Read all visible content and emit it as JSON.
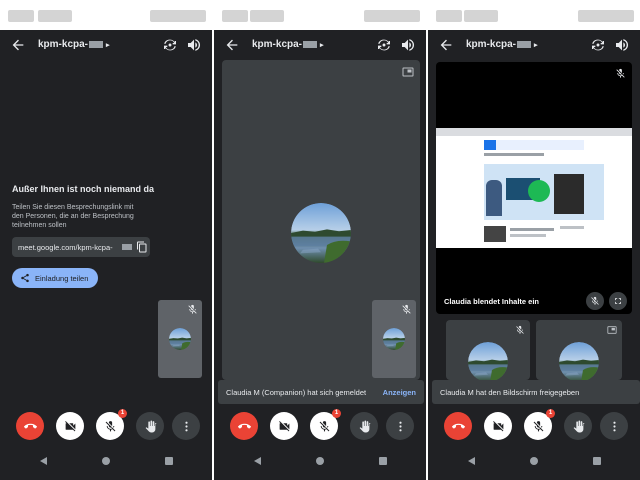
{
  "panels": [
    {
      "title": "kpm-kcpa-",
      "heading": "Außer Ihnen ist noch niemand da",
      "description": "Teilen Sie diesen Besprechungslink mit den Personen, die an der Besprechung teilnehmen sollen",
      "link": "meet.google.com/kpm-kcpa-",
      "share_label": "Einladung teilen"
    },
    {
      "title": "kpm-kcpa-",
      "toast_text": "Claudia M (Companion) hat sich gemeldet",
      "toast_action": "Anzeigen"
    },
    {
      "title": "kpm-kcpa-",
      "presenting_label": "Claudia blendet Inhalte ein",
      "toast_text": "Claudia M hat den Bildschirm freigegeben"
    }
  ],
  "badge_count": "1",
  "icons": {
    "back": "arrow-left-icon",
    "camera_switch": "camera-switch-icon",
    "speaker": "speaker-icon",
    "copy": "copy-icon",
    "share": "share-icon",
    "end_call": "end-call-icon",
    "camera_off": "camera-off-icon",
    "mic_off": "mic-off-icon",
    "raise_hand": "hand-icon",
    "more": "more-vert-icon",
    "pip": "picture-in-picture-icon",
    "fullscreen": "fullscreen-icon"
  },
  "colors": {
    "background": "#202124",
    "tile": "#3c4043",
    "end_call": "#ea4335",
    "accent": "#8ab4f8",
    "share_button": "#8ab4f8"
  }
}
